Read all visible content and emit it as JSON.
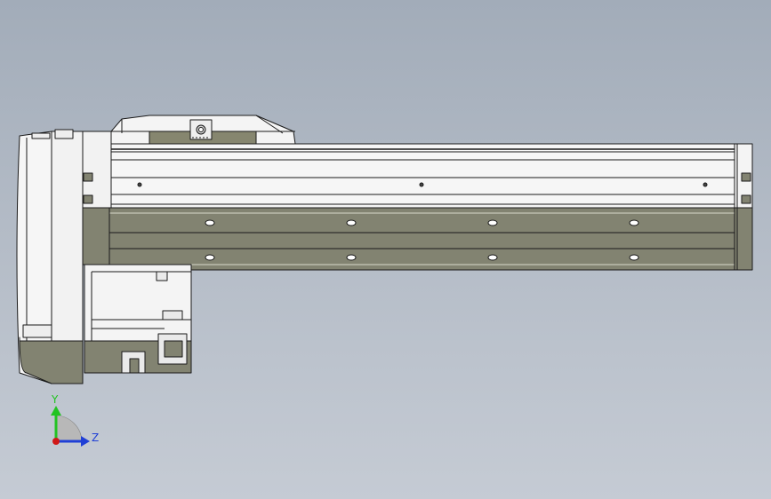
{
  "triad": {
    "y_label": "Y",
    "z_label": "Z",
    "y_color": "#22c322",
    "z_color": "#1f3fd6",
    "x_color": "#d01818"
  },
  "colors": {
    "background_top": "#a2acb9",
    "background_bottom": "#c5cbd4",
    "metal_light": "#f2f2f2",
    "metal_shadow": "#7a7b66",
    "edge": "#1a1a1a"
  }
}
